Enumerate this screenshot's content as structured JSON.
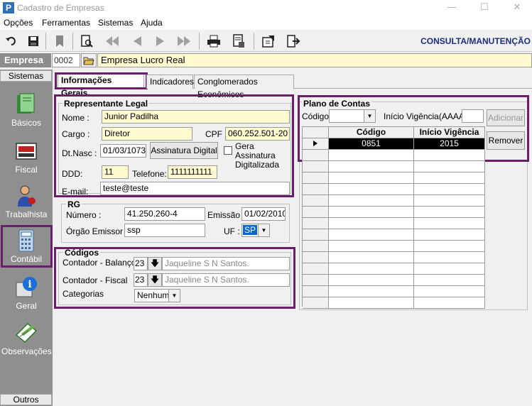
{
  "window": {
    "title": "Cadastro de Empresas",
    "app_icon": "P",
    "minimize": "—",
    "maximize": "☐",
    "close": "✕"
  },
  "menu": [
    "Opções",
    "Ferramentas",
    "Sistemas",
    "Ajuda"
  ],
  "toolbar": {
    "mode": "CONSULTA/MANUTENÇÃO"
  },
  "empresa": {
    "label": "Empresa",
    "code": "0002",
    "name": "Empresa Lucro Real"
  },
  "sidebar": {
    "header": "Sistemas",
    "footer": "Outros",
    "items": [
      {
        "label": "Básicos",
        "icon": "book-icon"
      },
      {
        "label": "Fiscal",
        "icon": "fiscal-icon"
      },
      {
        "label": "Trabalhista",
        "icon": "worker-icon"
      },
      {
        "label": "Contábil",
        "icon": "calculator-icon"
      },
      {
        "label": "Geral",
        "icon": "info-icon"
      },
      {
        "label": "Observações",
        "icon": "notes-icon"
      }
    ]
  },
  "tabs": [
    "Informações Gerais",
    "Indicadores",
    "Conglomerados Econômicos"
  ],
  "representante": {
    "title": "Representante Legal",
    "nome_label": "Nome :",
    "nome": "Junior Padilha",
    "cargo_label": "Cargo :",
    "cargo": "Diretor",
    "cpf_label": "CPF :",
    "cpf": "060.252.501-20",
    "nasc_label": "Dt.Nasc :",
    "nasc": "01/03/1073",
    "assinatura_button": "Assinatura Digital",
    "gera_assinatura": "Gera Assinatura Digitalizada",
    "ddd_label": "DDD:",
    "ddd": "11",
    "telefone_label": "Telefone:",
    "telefone": "1111111111",
    "email_label": "E-mail:",
    "email": "teste@teste"
  },
  "rg": {
    "title": "RG",
    "numero_label": "Número :",
    "numero": "41.250.260-4",
    "emissao_label": "Emissão :",
    "emissao": "01/02/2010",
    "orgao_label": "Órgão Emissor :",
    "orgao": "ssp",
    "uf_label": "UF :",
    "uf": "SP"
  },
  "codigos": {
    "title": "Códigos",
    "balanco_label": "Contador - Balanço",
    "balanco_code": "23",
    "balanco_name": "Jaqueline S N Santos.",
    "fiscal_label": "Contador - Fiscal",
    "fiscal_code": "23",
    "fiscal_name": "Jaqueline S N Santos.",
    "categorias_label": "Categorias",
    "categorias": "Nenhum"
  },
  "plano": {
    "title": "Plano de Contas",
    "codigo_label": "Código:",
    "inicio_label": "Início Vigência(AAAA):",
    "adicionar": "Adicionar",
    "remover": "Remover",
    "columns": [
      "Código",
      "Início Vigência"
    ],
    "rows": [
      {
        "codigo": "0851",
        "inicio": "2015"
      }
    ]
  }
}
